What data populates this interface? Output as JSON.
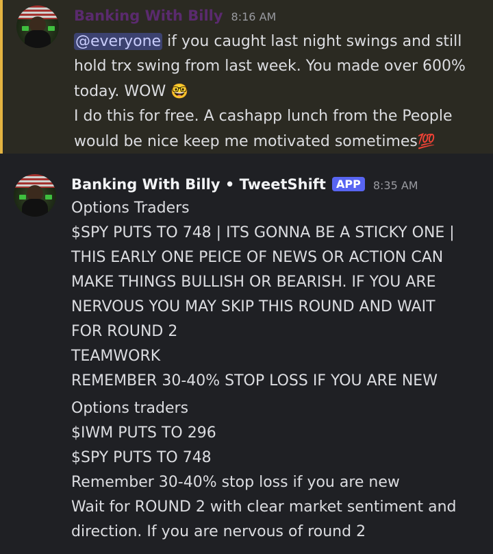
{
  "messages": [
    {
      "author": "Banking With Billy",
      "timestamp": "8:16 AM",
      "mention": "@everyone",
      "lines": [
        " if you caught last night swings and still",
        "hold trx swing from last week. You made over 600%",
        "today. WOW",
        "I do this for free. A cashapp lunch from the People",
        "would be nice keep me motivated sometimes"
      ],
      "emoji_nerd": "🤓",
      "emoji_100": "💯",
      "highlight_color": "#e3b341"
    },
    {
      "author": "Banking With Billy • TweetShift",
      "badge": "APP",
      "timestamp": "8:35 AM",
      "lines": [
        "Options Traders",
        "$SPY PUTS TO 748 | ITS GONNA BE A STICKY ONE |",
        "THIS EARLY ONE PEICE OF NEWS OR ACTION CAN",
        "MAKE THINGS BULLISH OR BEARISH. IF YOU ARE",
        "NERVOUS YOU MAY SKIP THIS ROUND AND WAIT",
        "FOR ROUND 2",
        "TEAMWORK",
        "REMEMBER 30-40% STOP LOSS IF YOU ARE NEW"
      ],
      "lines2": [
        "Options traders",
        "$IWM PUTS TO 296",
        "$SPY PUTS TO 748",
        "Remember 30-40% stop loss if you are new",
        "Wait for ROUND 2 with clear market sentiment and",
        "direction. If you are nervous of round 2"
      ],
      "badge_color": "#5865f2"
    }
  ]
}
